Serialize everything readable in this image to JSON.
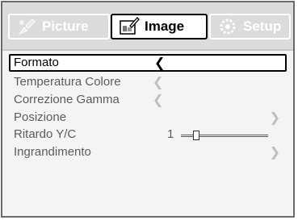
{
  "tabs": [
    {
      "label": "Picture",
      "icon": "palette-icon",
      "active": false
    },
    {
      "label": "Image",
      "icon": "image-edit-icon",
      "active": true
    },
    {
      "label": "Setup",
      "icon": "gear-icon",
      "active": false
    }
  ],
  "menu": {
    "items": [
      {
        "label": "Formato",
        "control": "left-arrow",
        "selected": true
      },
      {
        "label": "Temperatura Colore",
        "control": "left-arrow"
      },
      {
        "label": "Correzione Gamma",
        "control": "left-arrow"
      },
      {
        "label": "Posizione",
        "control": "right-arrow"
      },
      {
        "label": "Ritardo Y/C",
        "control": "slider",
        "value": "1",
        "slider_fraction": 0.15
      },
      {
        "label": "Ingrandimento",
        "control": "right-arrow"
      }
    ]
  },
  "colors": {
    "selected_border": "#000000",
    "disabled_text": "#5c5c5c",
    "tab_bar": "#dcdcdc"
  }
}
